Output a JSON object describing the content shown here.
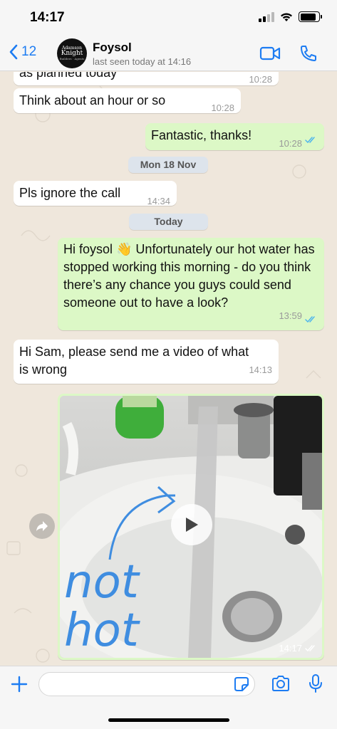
{
  "status_bar": {
    "time": "14:17",
    "battery_level": 0.85
  },
  "header": {
    "back_count": "12",
    "contact_name": "Foysol",
    "last_seen": "last seen today at 14:16",
    "avatar_text": {
      "line1": "Adamson",
      "line2": "Knight",
      "line3": "Builders · Agents"
    }
  },
  "messages": [
    {
      "dir": "in",
      "text": "as planned today",
      "time": "10:28"
    },
    {
      "dir": "in",
      "text": "Think about an hour or so",
      "time": "10:28"
    },
    {
      "dir": "out",
      "text": "Fantastic, thanks!",
      "time": "10:28",
      "read": true
    },
    {
      "dir": "date",
      "text": "Mon 18 Nov"
    },
    {
      "dir": "in",
      "text": "Pls ignore the call",
      "time": "14:34"
    },
    {
      "dir": "date",
      "text": "Today"
    },
    {
      "dir": "out",
      "text": "Hi foysol 👋 Unfortunately our hot water has stopped working this morning - do you think there’s any chance you guys could send someone out to have a look?",
      "time": "13:59",
      "read": true
    },
    {
      "dir": "in",
      "text": "Hi Sam, please send me a video of what is wrong",
      "time": "14:13"
    },
    {
      "dir": "out",
      "type": "video",
      "time": "14:17",
      "read": false,
      "handwriting": "not hot"
    }
  ],
  "composer": {
    "placeholder": ""
  },
  "colors": {
    "accent": "#1d7cf2",
    "outgoing": "#dcf8c6",
    "incoming": "#ffffff",
    "read_ticks": "#4fb6ec",
    "background": "#efe7dc"
  }
}
